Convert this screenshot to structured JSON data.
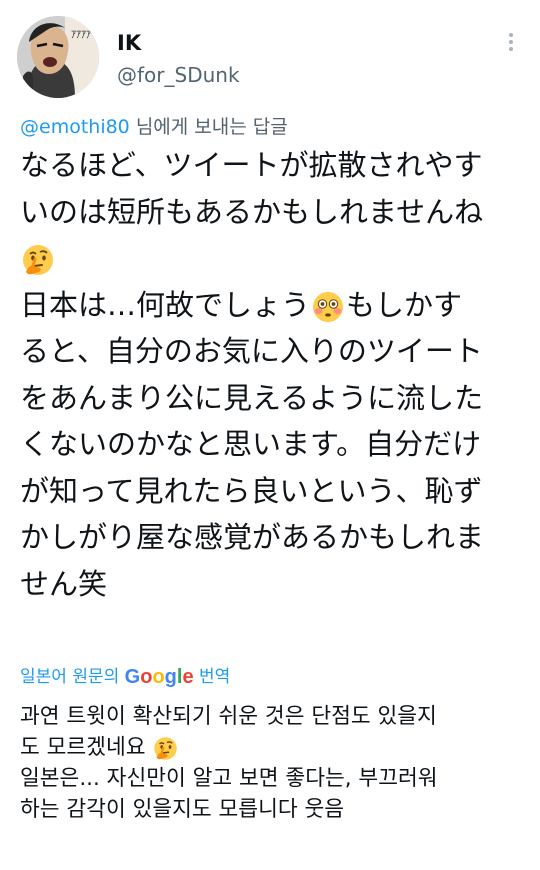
{
  "user": {
    "display_name": "IK",
    "handle": "@for_SDunk",
    "avatar_text": "ｱｱｱｱ"
  },
  "reply": {
    "mention": "@emothi80",
    "suffix": " 님에게 보내는 답글"
  },
  "tweet": {
    "lines": [
      "なるほど、ツイートが拡散されやす",
      "いのは短所もあるかもしれませんね",
      "日本は…何故でしょう",
      "もしかす",
      "ると、自分のお気に入りのツイート",
      "をあんまり公に見えるように流した",
      "くないのかなと思います。自分だけ",
      "が知って見れたら良いという、恥ず",
      "かしがり屋な感覚があるかもしれま",
      "せん笑"
    ],
    "emoji": [
      "thinking-face",
      "flushed-face"
    ]
  },
  "translation": {
    "prefix": "일본어 원문의 ",
    "google": [
      "G",
      "o",
      "o",
      "g",
      "l",
      "e"
    ],
    "suffix": " 번역",
    "lines": [
      "과연 트윗이 확산되기 쉬운 것은 단점도 있을지",
      "도 모르겠네요 ",
      "일본은... 자신만이 알고 보면 좋다는, 부끄러워",
      "하는 감각이 있을지도 모릅니다 웃음"
    ]
  },
  "colors": {
    "link": "#1d9bf0",
    "secondary": "#536471",
    "text": "#0f1419"
  }
}
